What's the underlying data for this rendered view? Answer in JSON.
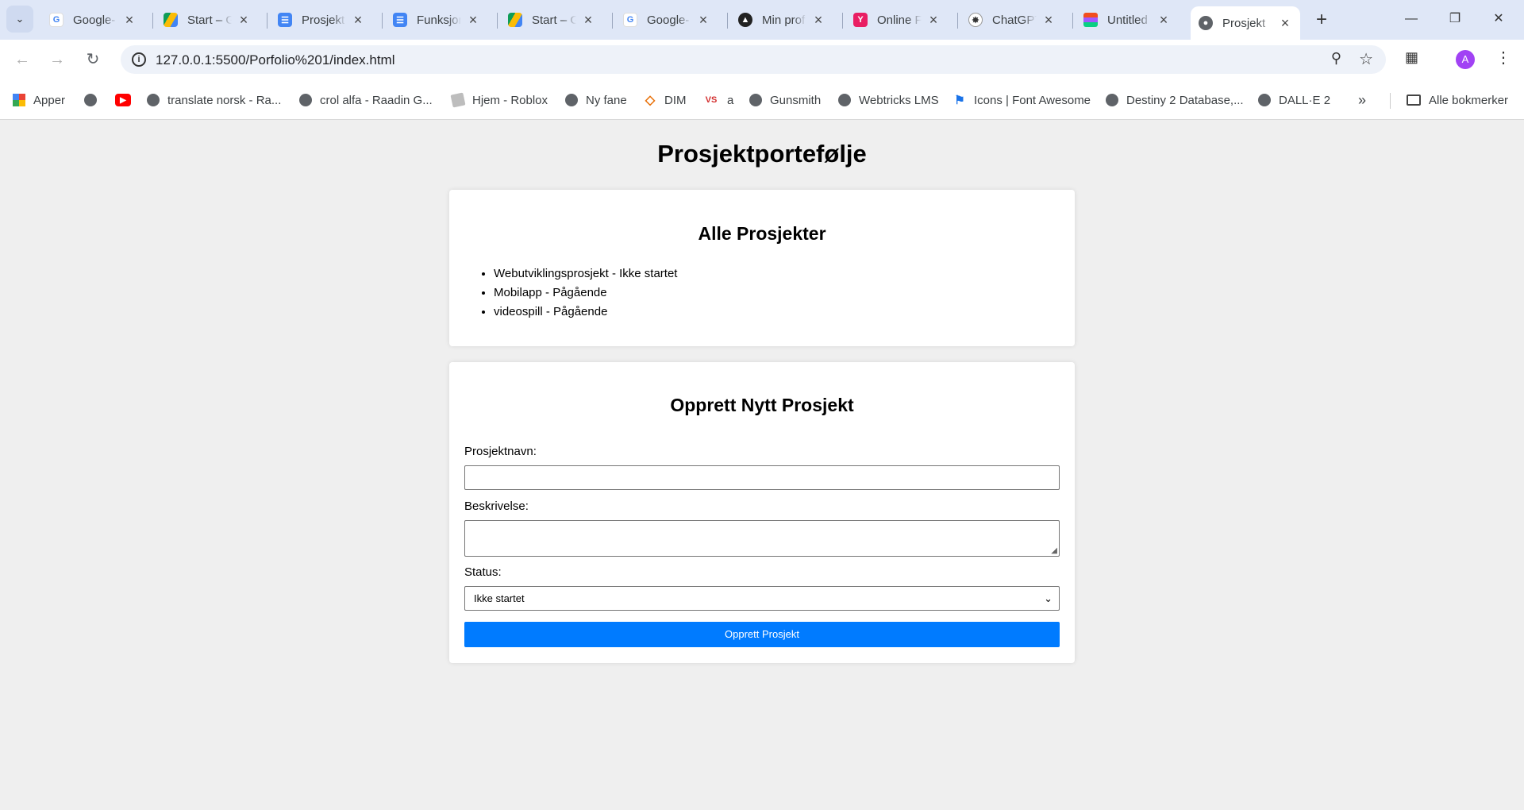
{
  "browser": {
    "tabs": [
      {
        "title": "Google-",
        "favicon": "google-icon"
      },
      {
        "title": "Start – G",
        "favicon": "drive-icon"
      },
      {
        "title": "Prosjekt",
        "favicon": "docs-icon"
      },
      {
        "title": "Funksjon",
        "favicon": "docs-icon"
      },
      {
        "title": "Start – G",
        "favicon": "drive-icon"
      },
      {
        "title": "Google-",
        "favicon": "google-icon"
      },
      {
        "title": "Min prof",
        "favicon": "profile-icon"
      },
      {
        "title": "Online F",
        "favicon": "y-logo-icon"
      },
      {
        "title": "ChatGPT",
        "favicon": "openai-icon"
      },
      {
        "title": "Untitled",
        "favicon": "figma-icon"
      },
      {
        "title": "Prosjekt",
        "favicon": "globe-icon"
      }
    ],
    "active_tab_index": 10,
    "url": "127.0.0.1:5500/Porfolio%201/index.html",
    "avatar_letter": "A",
    "bookmarks": [
      {
        "label": "Apper",
        "icon": "apps-grid-icon"
      },
      {
        "label": "",
        "icon": "globe-icon"
      },
      {
        "label": "",
        "icon": "youtube-icon"
      },
      {
        "label": "translate norsk - Ra...",
        "icon": "globe-icon"
      },
      {
        "label": "crol alfa - Raadin G...",
        "icon": "globe-icon"
      },
      {
        "label": "Hjem - Roblox",
        "icon": "roblox-icon"
      },
      {
        "label": "Ny fane",
        "icon": "globe-icon"
      },
      {
        "label": "DIM",
        "icon": "dim-icon"
      },
      {
        "label": "a",
        "icon": "vs-icon"
      },
      {
        "label": "Gunsmith",
        "icon": "globe-icon"
      },
      {
        "label": "Webtricks LMS",
        "icon": "globe-icon"
      },
      {
        "label": "Icons | Font Awesome",
        "icon": "flag-icon"
      },
      {
        "label": "Destiny 2 Database,...",
        "icon": "globe-icon"
      },
      {
        "label": "DALL·E 2",
        "icon": "globe-icon"
      }
    ],
    "all_bookmarks_label": "Alle bokmerker"
  },
  "page": {
    "title": "Prosjektportefølje",
    "projects_heading": "Alle Prosjekter",
    "projects": [
      "Webutviklingsprosjekt - Ikke startet",
      "Mobilapp - Pågående",
      "videospill - Pågående"
    ],
    "form": {
      "heading": "Opprett Nytt Prosjekt",
      "name_label": "Prosjektnavn:",
      "name_value": "",
      "description_label": "Beskrivelse:",
      "description_value": "",
      "status_label": "Status:",
      "status_value": "Ikke startet",
      "submit_label": "Opprett Prosjekt"
    }
  },
  "colors": {
    "page_background": "#efefef",
    "tabstrip": "#dfe7f7",
    "button": "#007bff"
  }
}
